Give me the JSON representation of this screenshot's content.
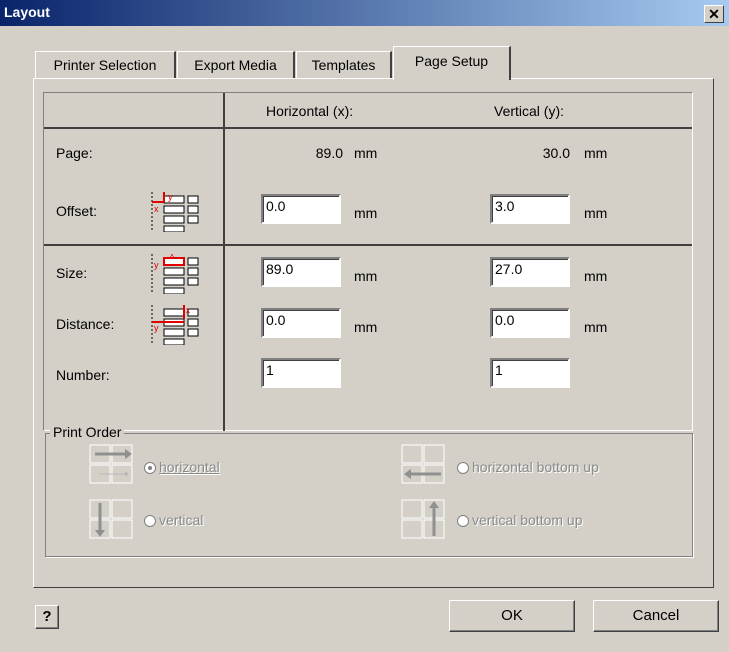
{
  "window": {
    "title": "Layout"
  },
  "tabs": [
    {
      "label": "Printer Selection"
    },
    {
      "label": "Export Media"
    },
    {
      "label": "Templates"
    },
    {
      "label": "Page Setup"
    }
  ],
  "table": {
    "headers": {
      "horizontal": "Horizontal (x):",
      "vertical": "Vertical (y):"
    },
    "unit": "mm",
    "page": {
      "label": "Page:",
      "horizontal": "89.0",
      "vertical": "30.0"
    },
    "offset": {
      "label": "Offset:",
      "horizontal": "0.0",
      "vertical": "3.0"
    },
    "size": {
      "label": "Size:",
      "horizontal": "89.0",
      "vertical": "27.0"
    },
    "distance": {
      "label": "Distance:",
      "horizontal": "0.0",
      "vertical": "0.0"
    },
    "number": {
      "label": "Number:",
      "horizontal": "1",
      "vertical": "1"
    }
  },
  "print_order": {
    "title": "Print Order",
    "options": [
      {
        "label": "horizontal",
        "selected": true
      },
      {
        "label": "vertical",
        "selected": false
      },
      {
        "label": "horizontal bottom up",
        "selected": false
      },
      {
        "label": "vertical bottom up",
        "selected": false
      }
    ]
  },
  "buttons": {
    "help": "?",
    "ok": "OK",
    "cancel": "Cancel"
  },
  "colors": {
    "face": "#d4d0c8",
    "title_start": "#0a246a",
    "title_end": "#a6caf0",
    "diagram_red": "#e00000"
  }
}
